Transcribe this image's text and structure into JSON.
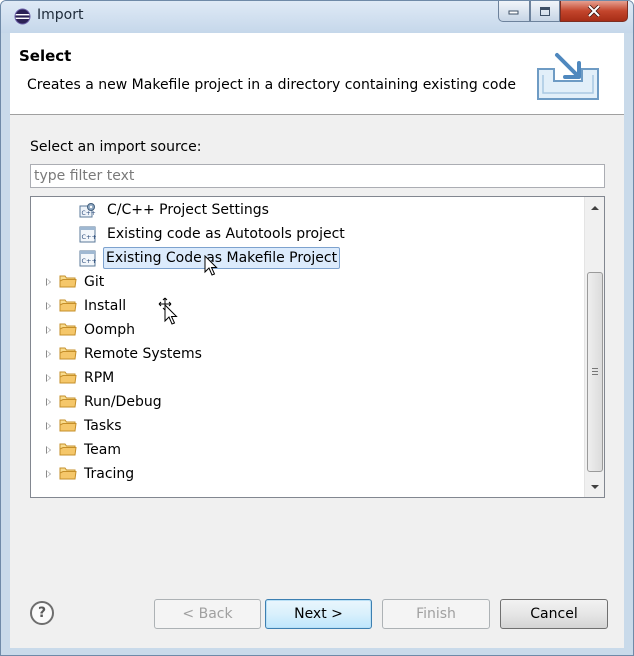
{
  "window": {
    "title": "Import",
    "buttons": {
      "minimize": "minimize",
      "maximize": "maximize",
      "close": "close"
    }
  },
  "header": {
    "title": "Select",
    "description": "Creates a new Makefile project in a directory containing existing code"
  },
  "source": {
    "label": "Select an import source:",
    "filter_placeholder": "type filter text",
    "filter_value": ""
  },
  "tree": {
    "items": [
      {
        "label": "C/C++ Project Settings",
        "icon": "cpp-settings-icon",
        "level": 1,
        "selected": false
      },
      {
        "label": "Existing code as Autotools project",
        "icon": "cpp-file-icon",
        "level": 1,
        "selected": false
      },
      {
        "label": "Existing Code as Makefile Project",
        "icon": "cpp-file-icon",
        "level": 1,
        "selected": true
      },
      {
        "label": "Git",
        "icon": "folder-icon",
        "level": 0,
        "selected": false
      },
      {
        "label": "Install",
        "icon": "folder-icon",
        "level": 0,
        "selected": false
      },
      {
        "label": "Oomph",
        "icon": "folder-icon",
        "level": 0,
        "selected": false
      },
      {
        "label": "Remote Systems",
        "icon": "folder-icon",
        "level": 0,
        "selected": false
      },
      {
        "label": "RPM",
        "icon": "folder-icon",
        "level": 0,
        "selected": false
      },
      {
        "label": "Run/Debug",
        "icon": "folder-icon",
        "level": 0,
        "selected": false
      },
      {
        "label": "Tasks",
        "icon": "folder-icon",
        "level": 0,
        "selected": false
      },
      {
        "label": "Team",
        "icon": "folder-icon",
        "level": 0,
        "selected": false
      },
      {
        "label": "Tracing",
        "icon": "folder-icon",
        "level": 0,
        "selected": false
      }
    ]
  },
  "footer": {
    "help": "?",
    "back": "< Back",
    "next": "Next >",
    "finish": "Finish",
    "cancel": "Cancel"
  },
  "colors": {
    "window_frame": "#c9daea",
    "selection_fill": "#dcebfc",
    "selection_border": "#7da2ce",
    "folder": "#f5c76a",
    "close_button": "#c3452c"
  }
}
